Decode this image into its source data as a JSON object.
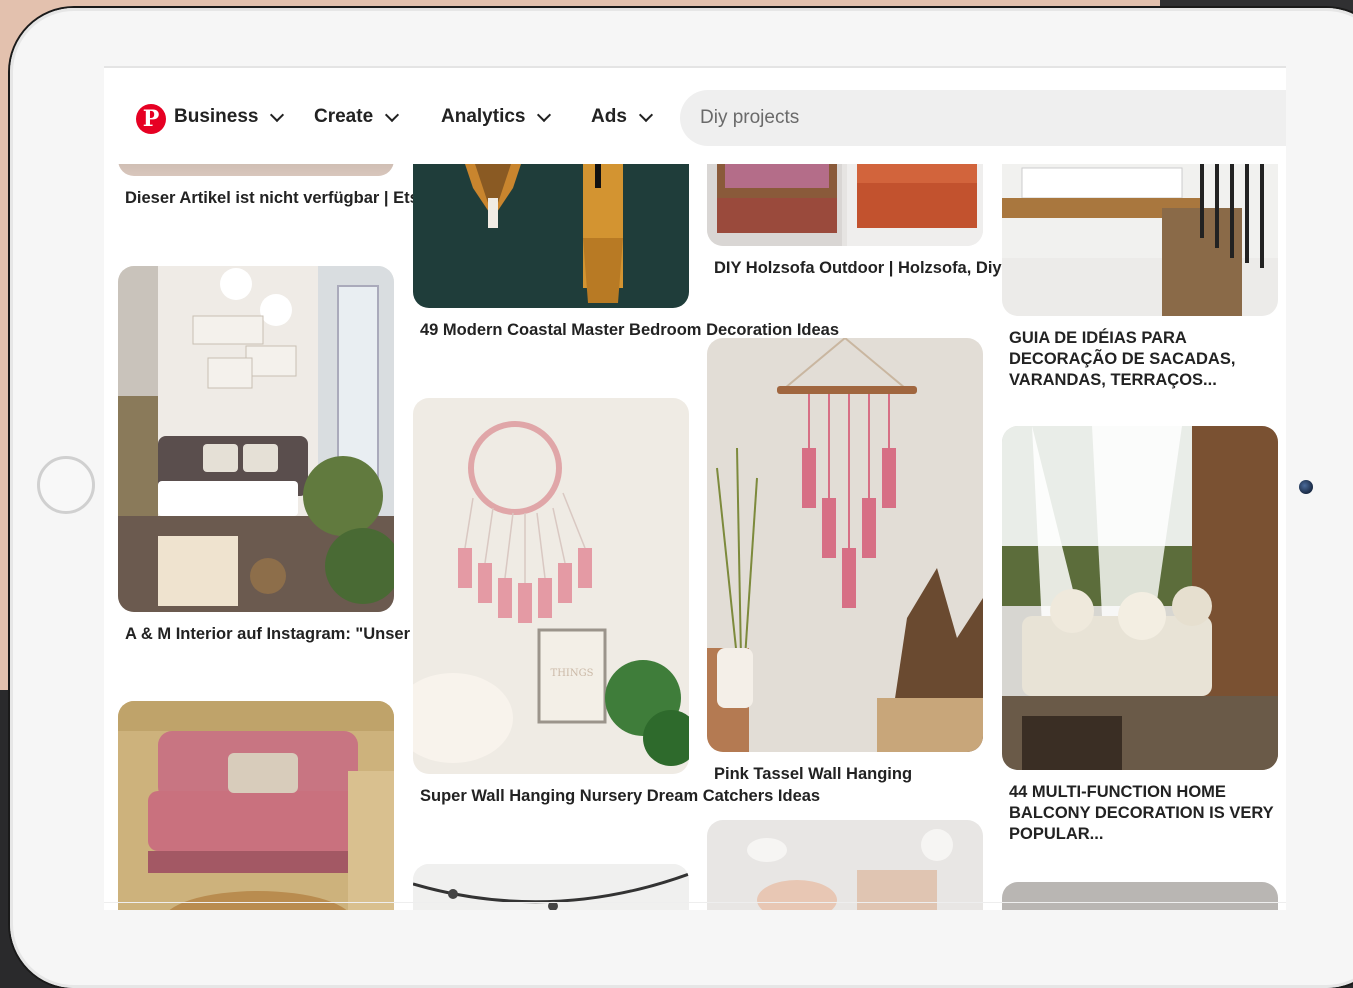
{
  "nav": {
    "logo": "P",
    "items": [
      {
        "label": "Business"
      },
      {
        "label": "Create"
      },
      {
        "label": "Analytics"
      },
      {
        "label": "Ads"
      }
    ]
  },
  "search": {
    "placeholder": "Diy projects"
  },
  "pins": {
    "col1": [
      {
        "title": "Dieser Artikel ist nicht verfügbar | Etsy"
      },
      {
        "title": "A & M Interior auf Instagram: \"Unser kleiner aber feiner..."
      },
      {
        "title": ""
      }
    ],
    "col2": [
      {
        "title": "49 Modern Coastal Master Bedroom Decoration Ideas"
      },
      {
        "title": "Super Wall Hanging Nursery Dream Catchers Ideas",
        "sign": "Do Small THINGS with Great LOVE"
      },
      {
        "title": ""
      }
    ],
    "col3": [
      {
        "title": "DIY Holzsofa Outdoor | Holzsofa, Diy möbel einfach, Diy..."
      },
      {
        "title": "Pink Tassel Wall Hanging"
      },
      {
        "title": ""
      }
    ],
    "col4": [
      {
        "title": "GUIA DE IDÉIAS PARA DECORAÇÃO DE SACADAS, VARANDAS, TERRAÇOS..."
      },
      {
        "title": "44 MULTI-FUNCTION HOME BALCONY DECORATION IS VERY POPULAR..."
      },
      {
        "title": ""
      }
    ]
  },
  "colors": {
    "brand": "#e60023",
    "peach_bg": "#e3c1ae",
    "tablet_frame": "#f6f6f6"
  }
}
